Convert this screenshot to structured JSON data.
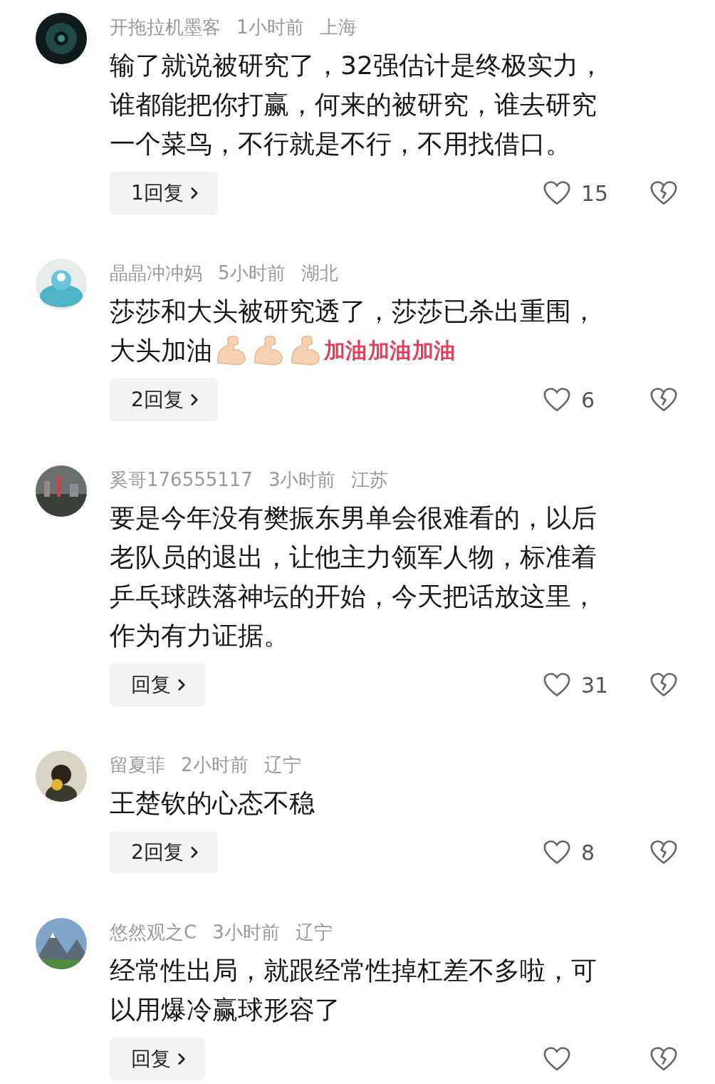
{
  "comments": [
    {
      "user": "开拖拉机墨客",
      "time": "1小时前",
      "location": "上海",
      "lines": [
        "输了就说被研究了，32强估计是终极实力，",
        "谁都能把你打赢，何来的被研究，谁去研究",
        "一个菜鸟，不行就是不行，不用找借口。"
      ],
      "replies": "1回复",
      "likes": "15"
    },
    {
      "user": "晶晶冲冲妈",
      "time": "5小时前",
      "location": "湖北",
      "lines": [
        "莎莎和大头被研究透了，莎莎已杀出重围，",
        "大头加油"
      ],
      "stickers": [
        {
          "kind": "arm"
        },
        {
          "kind": "arm"
        },
        {
          "kind": "arm"
        },
        {
          "kind": "cheer",
          "text": "加油"
        },
        {
          "kind": "cheer",
          "text": "加油"
        },
        {
          "kind": "cheer",
          "text": "加油"
        }
      ],
      "replies": "2回复",
      "likes": "6"
    },
    {
      "user": "奚哥176555117",
      "time": "3小时前",
      "location": "江苏",
      "lines": [
        "要是今年没有樊振东男单会很难看的，以后",
        "老队员的退出，让他主力领军人物，标准着",
        "乒乓球跌落神坛的开始，今天把话放这里，",
        "作为有力证据。"
      ],
      "replies": "回复",
      "likes": "31"
    },
    {
      "user": "留夏菲",
      "time": "2小时前",
      "location": "辽宁",
      "lines": [
        "王楚钦的心态不稳"
      ],
      "replies": "2回复",
      "likes": "8"
    },
    {
      "user": "悠然观之C",
      "time": "3小时前",
      "location": "辽宁",
      "lines": [
        "经常性出局，就跟经常性掉杠差不多啦，可",
        "以用爆冷赢球形容了"
      ],
      "replies": "回复"
    }
  ]
}
